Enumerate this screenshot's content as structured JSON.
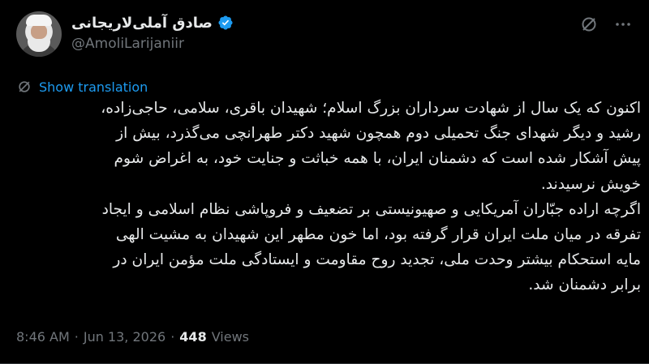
{
  "author": {
    "display_name": "صادق آملی‌لاریجانی",
    "handle": "@AmoliLarijaniir",
    "verified": true
  },
  "colors": {
    "background": "#000000",
    "text": "#e7e9ea",
    "secondary": "#71767b",
    "accent": "#1d9bf0"
  },
  "icons": {
    "grok": "grok-icon",
    "more": "more-icon",
    "translate": "translate-icon",
    "verified": "verified-badge-icon"
  },
  "tweet": {
    "translate_label": "Show translation",
    "paragraphs": [
      "اکنون که یک سال از شهادت سرداران بزرگ اسلام؛ شهیدان باقری، سلامی، حاجی‌زاده،\nرشید و دیگر شهدای جنگ تحمیلی دوم همچون شهید دکتر طهرانچی می‌گذرد، بیش از\nپیش آشکار شده است که دشمنان ایران، با همه خباثت و جنایت خود، به اغراض شوم\nخویش نرسیدند.",
      "اگرچه اراده جبّاران آمریکایی و صهیونیستی بر تضعیف و فروپاشی نظام اسلامی و ایجاد\nتفرقه در میان ملت ایران قرار گرفته بود، اما خون مطهر این شهیدان به مشیت الهی\nمایه استحکام بیشتر وحدت ملی، تجدید روح مقاومت و ایستادگی ملت مؤمن ایران در\nبرابر دشمنان شد."
    ],
    "time": "8:46 AM",
    "separator": "·",
    "date": "Jun 13, 2026",
    "views_count": "448",
    "views_label": "Views"
  }
}
